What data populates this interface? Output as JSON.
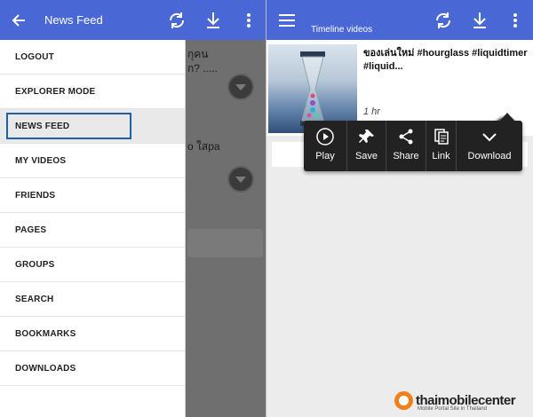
{
  "left_screen": {
    "topbar": {
      "title": "News Feed",
      "back_icon": "arrow-left-icon",
      "refresh_icon": "refresh-icon",
      "download_icon": "download-icon",
      "more_icon": "more-vert-icon"
    },
    "drawer": {
      "items": [
        {
          "label": "LOGOUT"
        },
        {
          "label": "EXPLORER MODE"
        },
        {
          "label": "NEWS FEED",
          "active": true
        },
        {
          "label": "MY VIDEOS"
        },
        {
          "label": "FRIENDS"
        },
        {
          "label": "PAGES"
        },
        {
          "label": "GROUPS"
        },
        {
          "label": "SEARCH"
        },
        {
          "label": "BOOKMARKS"
        },
        {
          "label": "DOWNLOADS"
        }
      ]
    },
    "background_feed": {
      "line1": "กุคน",
      "line2": "ก? .....",
      "line3": "o ใสpa"
    }
  },
  "right_screen": {
    "topbar": {
      "title": "Timeline videos",
      "menu_icon": "hamburger-menu-icon",
      "refresh_icon": "refresh-icon",
      "download_icon": "download-icon",
      "more_icon": "more-vert-icon"
    },
    "video": {
      "title": "ของเล่นใหม่ #hourglass #liquidtimer #liquid...",
      "time": "1 hr"
    },
    "popup_menu": {
      "items": [
        {
          "label": "Play",
          "icon": "play-circle-icon"
        },
        {
          "label": "Save",
          "icon": "pin-icon"
        },
        {
          "label": "Share",
          "icon": "share-icon"
        },
        {
          "label": "Link",
          "icon": "copy-link-icon"
        },
        {
          "label": "Download",
          "icon": "chevron-down-icon"
        }
      ]
    }
  },
  "watermark": {
    "brand": "thaimobilecenter",
    "tagline": "Mobile Portal Site in Thailand"
  },
  "colors": {
    "topbar": "#4a67d6",
    "active_highlight": "#1d5fa8",
    "popup_bg": "#222222",
    "logo_orange": "#f07f1d"
  }
}
